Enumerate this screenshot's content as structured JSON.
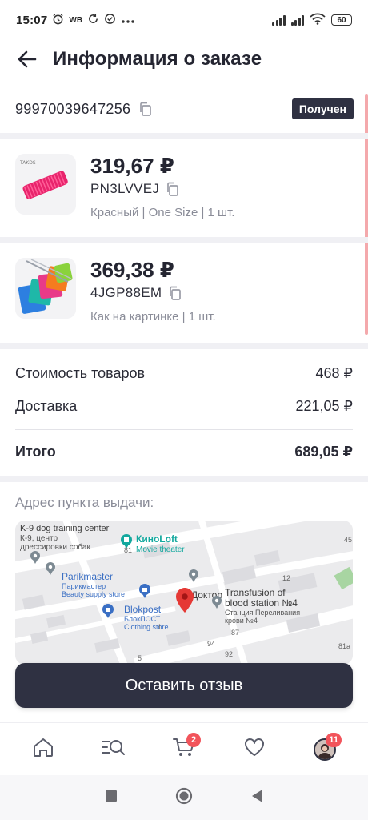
{
  "status_bar": {
    "time": "15:07",
    "wb_label": "WB",
    "battery": "60"
  },
  "header": {
    "title": "Информация о заказе"
  },
  "order": {
    "number": "99970039647256",
    "status": "Получен"
  },
  "products": [
    {
      "price": "319,67 ₽",
      "sku": "PN3LVVEJ",
      "variant": "Красный | One Size | 1 шт.",
      "thumb_brand": "TAKDS"
    },
    {
      "price": "369,38 ₽",
      "sku": "4JGP88EM",
      "variant": "Как на картинке | 1 шт."
    }
  ],
  "summary": {
    "goods_label": "Стоимость товаров",
    "goods_value": "468 ₽",
    "delivery_label": "Доставка",
    "delivery_value": "221,05 ₽",
    "total_label": "Итого",
    "total_value": "689,05 ₽"
  },
  "address": {
    "label": "Адрес пункта выдачи:",
    "map_labels": {
      "k9": "K-9 dog training center",
      "k9_ru_1": "К-9, центр",
      "k9_ru_2": "дрессировки собак",
      "kinoloft": "КиноLoft",
      "kinoloft_sub": "Movie theater",
      "parikmaster": "Parikmaster",
      "parikmaster_ru": "Парикмастер",
      "parikmaster_sub": "Beauty supply store",
      "blokpost": "Blokpost",
      "blokpost_ru": "БлокПОСТ",
      "blokpost_sub": "Clothing store",
      "doktor": "Доктор",
      "transfusion_1": "Transfusion of",
      "transfusion_2": "blood station №4",
      "transfusion_ru_1": "Станция Переливания",
      "transfusion_ru_2": "крови №4",
      "n81": "81",
      "n45": "45",
      "n12": "12",
      "n87": "87",
      "n94": "94",
      "n92": "92",
      "n81a": "81а",
      "n1": "1",
      "n5": "5"
    }
  },
  "actions": {
    "review_button": "Оставить отзыв"
  },
  "bottom_nav": {
    "cart_badge": "2",
    "profile_badge": "11"
  },
  "colors": {
    "accent_dark": "#2f3142",
    "badge_red": "#f2545b",
    "map_pin": "#e53935"
  }
}
